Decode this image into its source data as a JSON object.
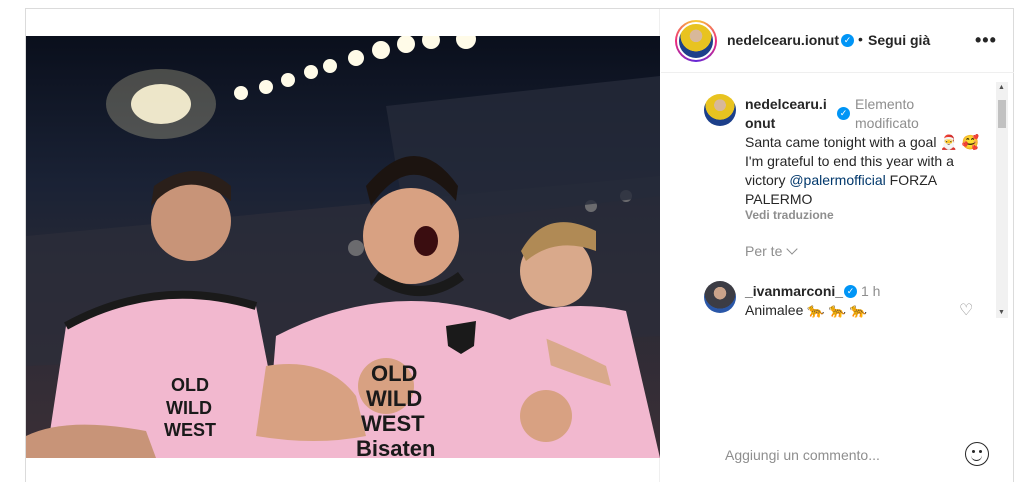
{
  "post": {
    "photo": {
      "description_icon": "football-celebration-photo",
      "jersey_text": "OLD WILD WEST",
      "sponsor_text": "Bisaten"
    }
  },
  "header": {
    "username": "nedelcearu.ionut",
    "separator": "•",
    "follow_label": "Segui già",
    "more_label": "•••"
  },
  "caption": {
    "username": "nedelcearu.i\nonut",
    "edited_label": "Elemento modificato",
    "text_before": "Santa came tonight with a goal 🎅 🥰\nI'm grateful to end this year with a victory ",
    "mention": "@palermofficial",
    "text_after": " FORZA PALERMO",
    "translate_label": "Vedi traduzione"
  },
  "filter": {
    "label": "Per te"
  },
  "comments": [
    {
      "username": "_ivanmarconi_",
      "time": "1 h",
      "text": "Animalee 🐆 🐆 🐆"
    }
  ],
  "add_comment": {
    "placeholder": "Aggiungi un commento..."
  },
  "colors": {
    "accent_blue": "#0095f6",
    "text_primary": "#262626",
    "text_secondary": "#8e8e8e",
    "mention": "#00376b",
    "jersey_pink": "#f2b8cf"
  }
}
